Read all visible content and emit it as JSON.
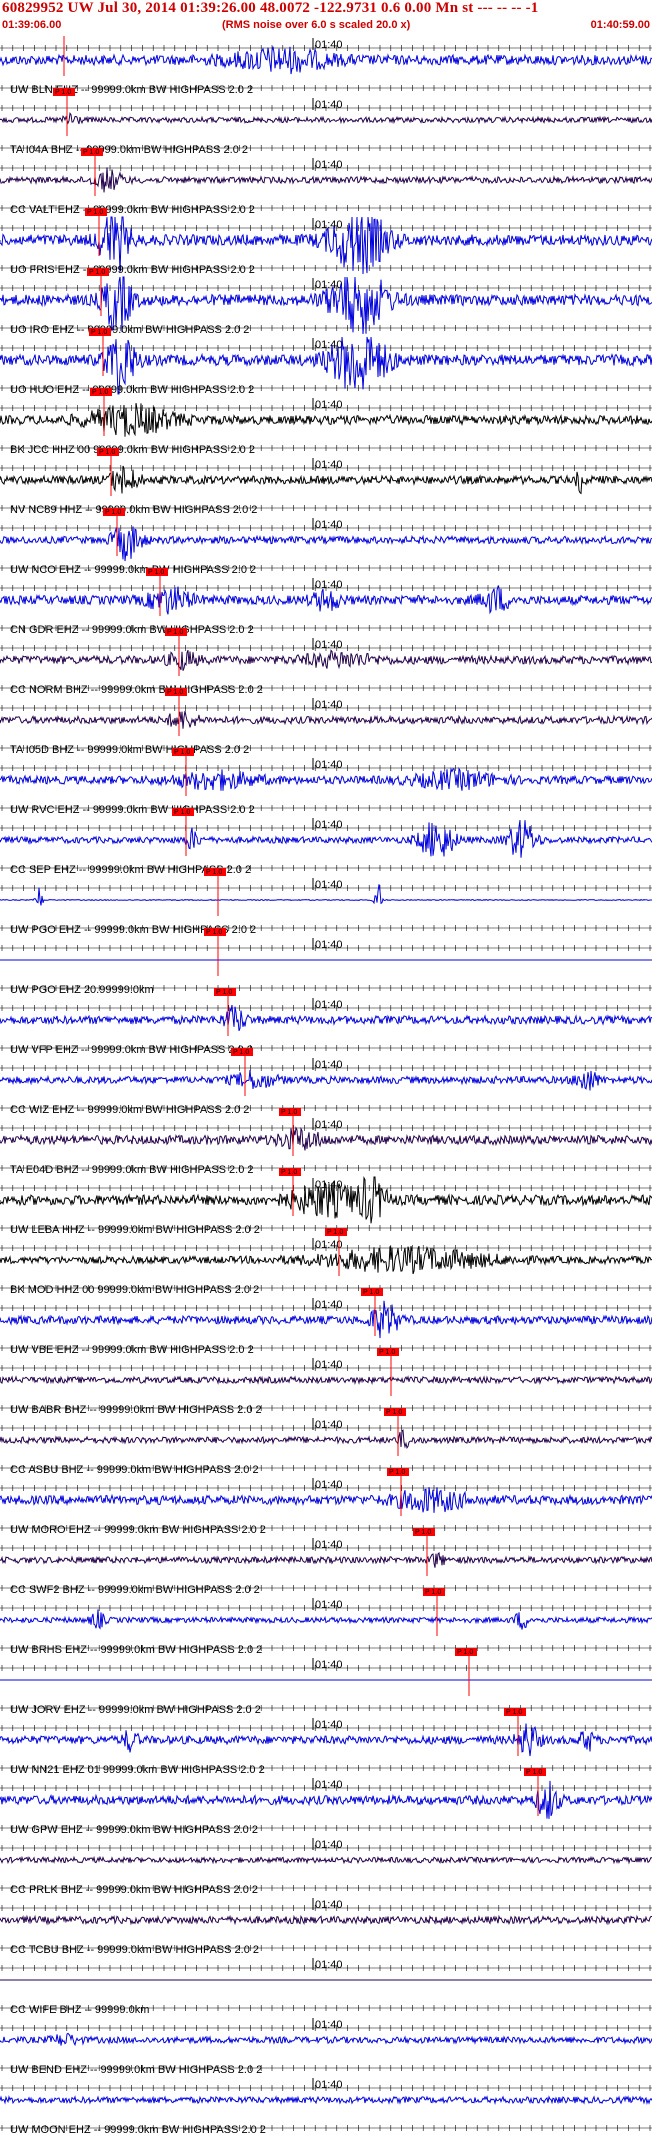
{
  "header": {
    "title": "60829952 UW Jul 30, 2014 01:39:26.00   48.0072 -122.9731  0.6 0.00 Mn st --- -- --  -1",
    "start_time": "01:39:06.00",
    "rms_note": "(RMS noise over 6.0 s scaled 20.0 x)",
    "end_time": "01:40:59.00"
  },
  "tick_label": "01:40",
  "pick_label": "P 1.0",
  "colors": {
    "title": "#cc0000",
    "pick": "#ff0000",
    "blue": "#0000dd",
    "dark": "#22004a",
    "black": "#000000"
  },
  "traces": [
    {
      "label": "UW BLN EHZ -- 99999.0km BW  HIGHPASS  2.0  2",
      "color": "blue",
      "amp": 0.55,
      "pick": 0.098,
      "bursts": [
        [
          0.43,
          0.07,
          2.0
        ]
      ],
      "baseline_bits": false
    },
    {
      "label": "TA I04A BHZ -- 99999.0km BW  HIGHPASS  2.0  2",
      "color": "dark",
      "amp": 0.3,
      "pick": 0.102,
      "bursts": [
        [
          0.11,
          0.01,
          3.0
        ]
      ]
    },
    {
      "label": "CC VALT EHZ -- 99999.0km BW  HIGHPASS  2.0  2",
      "color": "dark",
      "amp": 0.35,
      "pick": 0.145,
      "bursts": [
        [
          0.165,
          0.02,
          3.2
        ]
      ]
    },
    {
      "label": "UO FRIS EHZ -- 99999.0km BW  HIGHPASS  2.0  2",
      "color": "blue",
      "amp": 0.6,
      "pick": 0.152,
      "bursts": [
        [
          0.175,
          0.02,
          6.0
        ],
        [
          0.55,
          0.04,
          6.0
        ]
      ]
    },
    {
      "label": "UO IRO EHZ -- 99999.0km BW  HIGHPASS  2.0  2",
      "color": "blue",
      "amp": 0.6,
      "pick": 0.155,
      "bursts": [
        [
          0.18,
          0.02,
          6.0
        ],
        [
          0.55,
          0.04,
          6.0
        ]
      ]
    },
    {
      "label": "UO HUO EHZ -- 99999.0km BW  HIGHPASS  2.0  2",
      "color": "blue",
      "amp": 0.6,
      "pick": 0.158,
      "bursts": [
        [
          0.185,
          0.02,
          6.0
        ],
        [
          0.55,
          0.04,
          6.0
        ]
      ]
    },
    {
      "label": "BK JCC HHZ 00 99999.0km BW  HIGHPASS  2.0  2",
      "color": "black",
      "amp": 0.5,
      "pick": 0.16,
      "bursts": [
        [
          0.2,
          0.06,
          3.0
        ]
      ]
    },
    {
      "label": "NV NC89 HHZ -- 99999.0km BW  HIGHPASS  2.0  2",
      "color": "black",
      "amp": 0.45,
      "pick": 0.17,
      "bursts": [
        [
          0.19,
          0.02,
          3.0
        ],
        [
          0.89,
          0.005,
          3.0
        ]
      ]
    },
    {
      "label": "UW NCO EHZ -- 99999.0km BW  HIGHPASS  2.0  2",
      "color": "blue",
      "amp": 0.4,
      "pick": 0.18,
      "bursts": [
        [
          0.195,
          0.02,
          5.0
        ]
      ]
    },
    {
      "label": "CN GDR EHZ -- 99999.0km BW  HIGHPASS  2.0  2",
      "color": "blue",
      "amp": 0.5,
      "pick": 0.245,
      "bursts": [
        [
          0.26,
          0.03,
          2.5
        ],
        [
          0.5,
          0.02,
          2.0
        ],
        [
          0.76,
          0.02,
          2.5
        ]
      ]
    },
    {
      "label": "CC NORM BHZ -- 99999.0km BW  HIGHPASS  2.0  2",
      "color": "dark",
      "amp": 0.45,
      "pick": 0.275,
      "bursts": [
        [
          0.28,
          0.02,
          2.0
        ],
        [
          0.52,
          0.05,
          1.5
        ]
      ]
    },
    {
      "label": "TA I05D BHZ -- 99999.0km BW  HIGHPASS  2.0  2",
      "color": "dark",
      "amp": 0.4,
      "pick": 0.275,
      "bursts": [
        [
          0.28,
          0.02,
          2.2
        ]
      ]
    },
    {
      "label": "UW RVC EHZ -- 99999.0km BW  HIGHPASS  2.0  2",
      "color": "blue",
      "amp": 0.45,
      "pick": 0.285,
      "bursts": [
        [
          0.33,
          0.06,
          1.8
        ],
        [
          0.7,
          0.06,
          1.8
        ]
      ]
    },
    {
      "label": "CC SEP EHZ -- 99999.0km BW  HIGHPASS  2.0  2",
      "color": "blue",
      "amp": 0.35,
      "pick": 0.285,
      "bursts": [
        [
          0.295,
          0.01,
          3.0
        ],
        [
          0.67,
          0.025,
          6.0
        ],
        [
          0.8,
          0.02,
          6.0
        ]
      ]
    },
    {
      "label": "UW PGO EHZ -- 99999.0km BW  HIGHPASS  2.0  2",
      "color": "blue",
      "amp": 0.05,
      "pick": 0.335,
      "bursts": [
        [
          0.06,
          0.005,
          30.0
        ],
        [
          0.58,
          0.005,
          40.0
        ]
      ]
    },
    {
      "label": "UW PGO EHZ 20.99999.0km",
      "color": "blue",
      "amp": 0.0,
      "pick": 0.335,
      "bursts": []
    },
    {
      "label": "UW VFP EHZ -- 99999.0km BW  HIGHPASS  2.0  2",
      "color": "blue",
      "amp": 0.45,
      "pick": 0.35,
      "bursts": [
        [
          0.36,
          0.015,
          3.0
        ]
      ]
    },
    {
      "label": "CC WIZ EHZ -- 99999.0km BW  HIGHPASS  2.0  2",
      "color": "blue",
      "amp": 0.4,
      "pick": 0.375,
      "bursts": [
        [
          0.39,
          0.03,
          2.0
        ],
        [
          0.9,
          0.015,
          3.0
        ]
      ]
    },
    {
      "label": "TA E04D BHZ -- 99999.0km BW  HIGHPASS  2.0  2",
      "color": "dark",
      "amp": 0.5,
      "pick": 0.45,
      "bursts": [
        [
          0.46,
          0.03,
          2.0
        ]
      ]
    },
    {
      "label": "UW LEBA HHZ -- 99999.0km BW  HIGHPASS  2.0  2",
      "color": "black",
      "amp": 0.55,
      "pick": 0.45,
      "bursts": [
        [
          0.5,
          0.05,
          3.0
        ],
        [
          0.57,
          0.02,
          4.0
        ]
      ]
    },
    {
      "label": "BK MOD HHZ 00 99999.0km BW  HIGHPASS  2.0  2",
      "color": "black",
      "amp": 0.4,
      "pick": 0.52,
      "bursts": [
        [
          0.62,
          0.12,
          3.0
        ]
      ]
    },
    {
      "label": "UW VBE EHZ -- 99999.0km BW  HIGHPASS  2.0  2",
      "color": "blue",
      "amp": 0.45,
      "pick": 0.575,
      "bursts": [
        [
          0.59,
          0.02,
          4.0
        ]
      ]
    },
    {
      "label": "UW BABR BHZ -- 99999.0km BW  HIGHPASS  2.0  2",
      "color": "dark",
      "amp": 0.35,
      "pick": 0.6,
      "bursts": []
    },
    {
      "label": "CC ASBU BHZ -- 99999.0km BW  HIGHPASS  2.0  2",
      "color": "dark",
      "amp": 0.35,
      "pick": 0.61,
      "bursts": [
        [
          0.62,
          0.01,
          2.5
        ]
      ]
    },
    {
      "label": "UW MORO EHZ -- 99999.0km BW  HIGHPASS  2.0  2",
      "color": "blue",
      "amp": 0.5,
      "pick": 0.615,
      "bursts": [
        [
          0.66,
          0.05,
          2.2
        ]
      ]
    },
    {
      "label": "CC SWF2 BHZ -- 99999.0km BW  HIGHPASS  2.0  2",
      "color": "dark",
      "amp": 0.35,
      "pick": 0.655,
      "bursts": [
        [
          0.67,
          0.01,
          2.0
        ]
      ]
    },
    {
      "label": "UW BRHS EHZ -- 99999.0km BW  HIGHPASS  2.0  2",
      "color": "blue",
      "amp": 0.3,
      "pick": 0.67,
      "bursts": [
        [
          0.15,
          0.01,
          3.0
        ],
        [
          0.8,
          0.01,
          3.0
        ]
      ]
    },
    {
      "label": "UW JORV EHZ -- 99999.0km BW  HIGHPASS  2.0  2",
      "color": "blue",
      "amp": 0.0,
      "pick": 0.72,
      "bursts": []
    },
    {
      "label": "UW NN21 EHZ 01 99999.0km BW  HIGHPASS  2.0  2",
      "color": "blue",
      "amp": 0.45,
      "pick": 0.795,
      "bursts": [
        [
          0.2,
          0.01,
          2.5
        ],
        [
          0.81,
          0.015,
          4.0
        ],
        [
          0.9,
          0.01,
          2.5
        ]
      ]
    },
    {
      "label": "UW GPW EHZ -- 99999.0km BW  HIGHPASS  2.0  2",
      "color": "blue",
      "amp": 0.5,
      "pick": 0.825,
      "bursts": [
        [
          0.84,
          0.015,
          4.0
        ]
      ]
    },
    {
      "label": "CC PRLK BHZ -- 99999.0km BW  HIGHPASS  2.0  2",
      "color": "dark",
      "amp": 0.3,
      "pick": null,
      "bursts": []
    },
    {
      "label": "CC TCBU BHZ -- 99999.0km BW  HIGHPASS  2.0  2",
      "color": "dark",
      "amp": 0.4,
      "pick": null,
      "bursts": []
    },
    {
      "label": "CC WIFE BHZ -- 99999.0km",
      "color": "dark",
      "amp": 0.0,
      "pick": null,
      "bursts": []
    },
    {
      "label": "UW BEND EHZ -- 99999.0km BW  HIGHPASS  2.0  2",
      "color": "blue",
      "amp": 0.35,
      "pick": null,
      "bursts": [
        [
          0.1,
          0.02,
          1.5
        ]
      ]
    },
    {
      "label": "UW MOON EHZ -- 99999.0km BW  HIGHPASS  2.0  2",
      "color": "blue",
      "amp": 0.35,
      "pick": null,
      "bursts": []
    }
  ]
}
